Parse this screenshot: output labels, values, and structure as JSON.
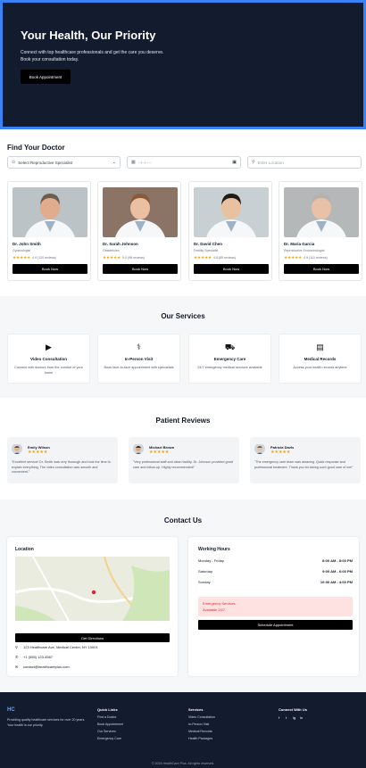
{
  "hero": {
    "title": "Your Health, Our Priority",
    "subtitle_line1": "Connect with top healthcare professionals and get the care you deserve.",
    "subtitle_line2": "Book your consultation today.",
    "button": "Book Appointment"
  },
  "find": {
    "title": "Find Your Doctor",
    "specialist_value": "Select Reproductive Specialist",
    "date_placeholder": "--/--/----",
    "location_placeholder": "Enter Location"
  },
  "doctors": [
    {
      "name": "Dr. John Smith",
      "specialty": "Gynecologist",
      "rating": "4.9 (120 reviews)",
      "stars": "★★★★★",
      "button": "Book Now",
      "photo_bg": "#bcc3c7",
      "hair": "#6b5d4f",
      "skin": "#e0ac8d"
    },
    {
      "name": "Dr. Sarah Johnson",
      "specialty": "Obstetrician",
      "rating": "5.0 (98 reviews)",
      "stars": "★★★★★",
      "button": "Book Now",
      "photo_bg": "#8b7466",
      "hair": "#8a5a36",
      "skin": "#ebbfa1"
    },
    {
      "name": "Dr. David Chen",
      "specialty": "Fertility Specialist",
      "rating": "4.8 (85 reviews)",
      "stars": "★★★★★",
      "button": "Book Now",
      "photo_bg": "#c9d0d4",
      "hair": "#1f1a17",
      "skin": "#e8c2a0"
    },
    {
      "name": "Dr. Maria Garcia",
      "specialty": "Reproductive Endocrinologist",
      "rating": "4.9 (110 reviews)",
      "stars": "★★★★★",
      "button": "Book Now",
      "photo_bg": "#b4b8b8",
      "hair": "#b6b2ab",
      "skin": "#e9c1a6"
    }
  ],
  "services": {
    "title": "Our Services",
    "items": [
      {
        "icon": "video-camera-icon",
        "glyph": "■◀",
        "title": "Video Consultation",
        "desc": "Connect with doctors from the comfort of your home"
      },
      {
        "icon": "user-doctor-icon",
        "glyph": "●",
        "title": "In-Person Visit",
        "desc": "Book face-to-face appointment with specialists"
      },
      {
        "icon": "ambulance-icon",
        "glyph": "■",
        "title": "Emergency Care",
        "desc": "24/7 emergency medical services available"
      },
      {
        "icon": "medical-file-icon",
        "glyph": "▉",
        "title": "Medical Records",
        "desc": "Access your health records anytime"
      }
    ]
  },
  "reviews": {
    "title": "Patient Reviews",
    "items": [
      {
        "name": "Emily Wilson",
        "stars": "★★★★★",
        "text": "\"Excellent service! Dr. Smith was very thorough and took the time to explain everything. The video consultation was smooth and convenient.\"",
        "skin": "#e3b58f",
        "hair": "#6b4a2e"
      },
      {
        "name": "Michael Brown",
        "stars": "★★★★★",
        "text": "\"Very professional staff and clean facility. Dr. Johnson provided great care and follow-up. Highly recommended!\"",
        "skin": "#d9a982",
        "hair": "#2e2620"
      },
      {
        "name": "Patricia Davis",
        "stars": "★★★★★",
        "text": "\"The emergency care team was amazing. Quick response and professional treatment. Thank you for taking such good care of me!\"",
        "skin": "#e8c0a5",
        "hair": "#6f5a4a"
      }
    ]
  },
  "contact": {
    "title": "Contact Us",
    "location_title": "Location",
    "directions_button": "Get Directions",
    "address": "123 Healthcare Ave, Medical Center, NY 10001",
    "phone": "+1 (555) 123-4567",
    "email": "contact@healthcareplus.com"
  },
  "hours": {
    "title": "Working Hours",
    "rows": [
      {
        "day": "Monday - Friday",
        "time": "8:00 AM - 8:00 PM"
      },
      {
        "day": "Saturday",
        "time": "9:00 AM - 6:00 PM"
      },
      {
        "day": "Sunday",
        "time": "10:00 AM - 4:00 PM"
      }
    ],
    "emergency_title": "Emergency Services",
    "emergency_sub": "Available 24/7",
    "schedule_button": "Schedule Appointment"
  },
  "footer": {
    "logo": "HC",
    "tagline": "Providing quality healthcare services for over 20 years. Your health is our priority.",
    "quick_title": "Quick Links",
    "quick": [
      "Find a Doctor",
      "Book Appointment",
      "Our Services",
      "Emergency Care"
    ],
    "services_title": "Services",
    "services": [
      "Video Consultation",
      "In-Person Visit",
      "Medical Records",
      "Health Packages"
    ],
    "connect_title": "Connect With Us",
    "social": [
      "f",
      "t",
      "ig",
      "in"
    ],
    "copyright": "© 2024 HealthCare Plus. All rights reserved."
  },
  "colors": {
    "navy": "#131b2e",
    "accent_border": "#3b82f6",
    "star": "#f59e0b",
    "emergency_bg": "#fee2e2",
    "emergency_text": "#dc2626"
  }
}
